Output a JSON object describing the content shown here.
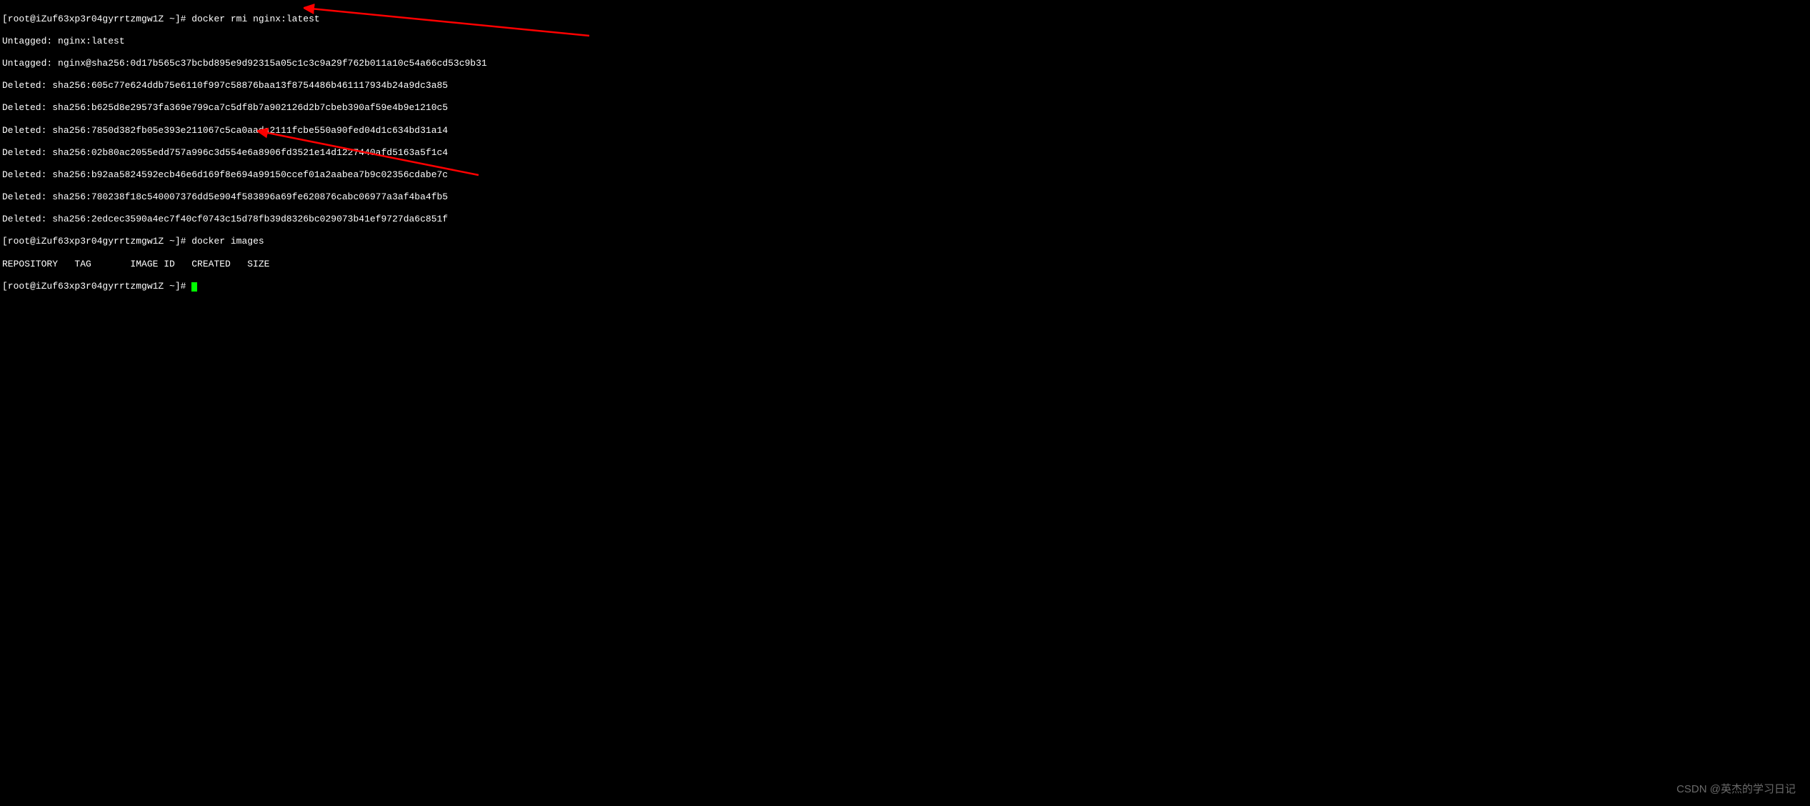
{
  "terminal": {
    "prompt1": "[root@iZuf63xp3r04gyrrtzmgw1Z ~]# ",
    "cmd1": "docker rmi nginx:latest",
    "lines": [
      "Untagged: nginx:latest",
      "Untagged: nginx@sha256:0d17b565c37bcbd895e9d92315a05c1c3c9a29f762b011a10c54a66cd53c9b31",
      "Deleted: sha256:605c77e624ddb75e6110f997c58876baa13f8754486b461117934b24a9dc3a85",
      "Deleted: sha256:b625d8e29573fa369e799ca7c5df8b7a902126d2b7cbeb390af59e4b9e1210c5",
      "Deleted: sha256:7850d382fb05e393e211067c5ca0aada2111fcbe550a90fed04d1c634bd31a14",
      "Deleted: sha256:02b80ac2055edd757a996c3d554e6a8906fd3521e14d1227440afd5163a5f1c4",
      "Deleted: sha256:b92aa5824592ecb46e6d169f8e694a99150ccef01a2aabea7b9c02356cdabe7c",
      "Deleted: sha256:780238f18c540007376dd5e904f583896a69fe620876cabc06977a3af4ba4fb5",
      "Deleted: sha256:2edcec3590a4ec7f40cf0743c15d78fb39d8326bc029073b41ef9727da6c851f"
    ],
    "prompt2": "[root@iZuf63xp3r04gyrrtzmgw1Z ~]# ",
    "cmd2": "docker images",
    "table_header": "REPOSITORY   TAG       IMAGE ID   CREATED   SIZE",
    "prompt3": "[root@iZuf63xp3r04gyrrtzmgw1Z ~]# "
  },
  "watermark": "CSDN @英杰的学习日记",
  "arrows": {
    "color": "#ff0000"
  }
}
